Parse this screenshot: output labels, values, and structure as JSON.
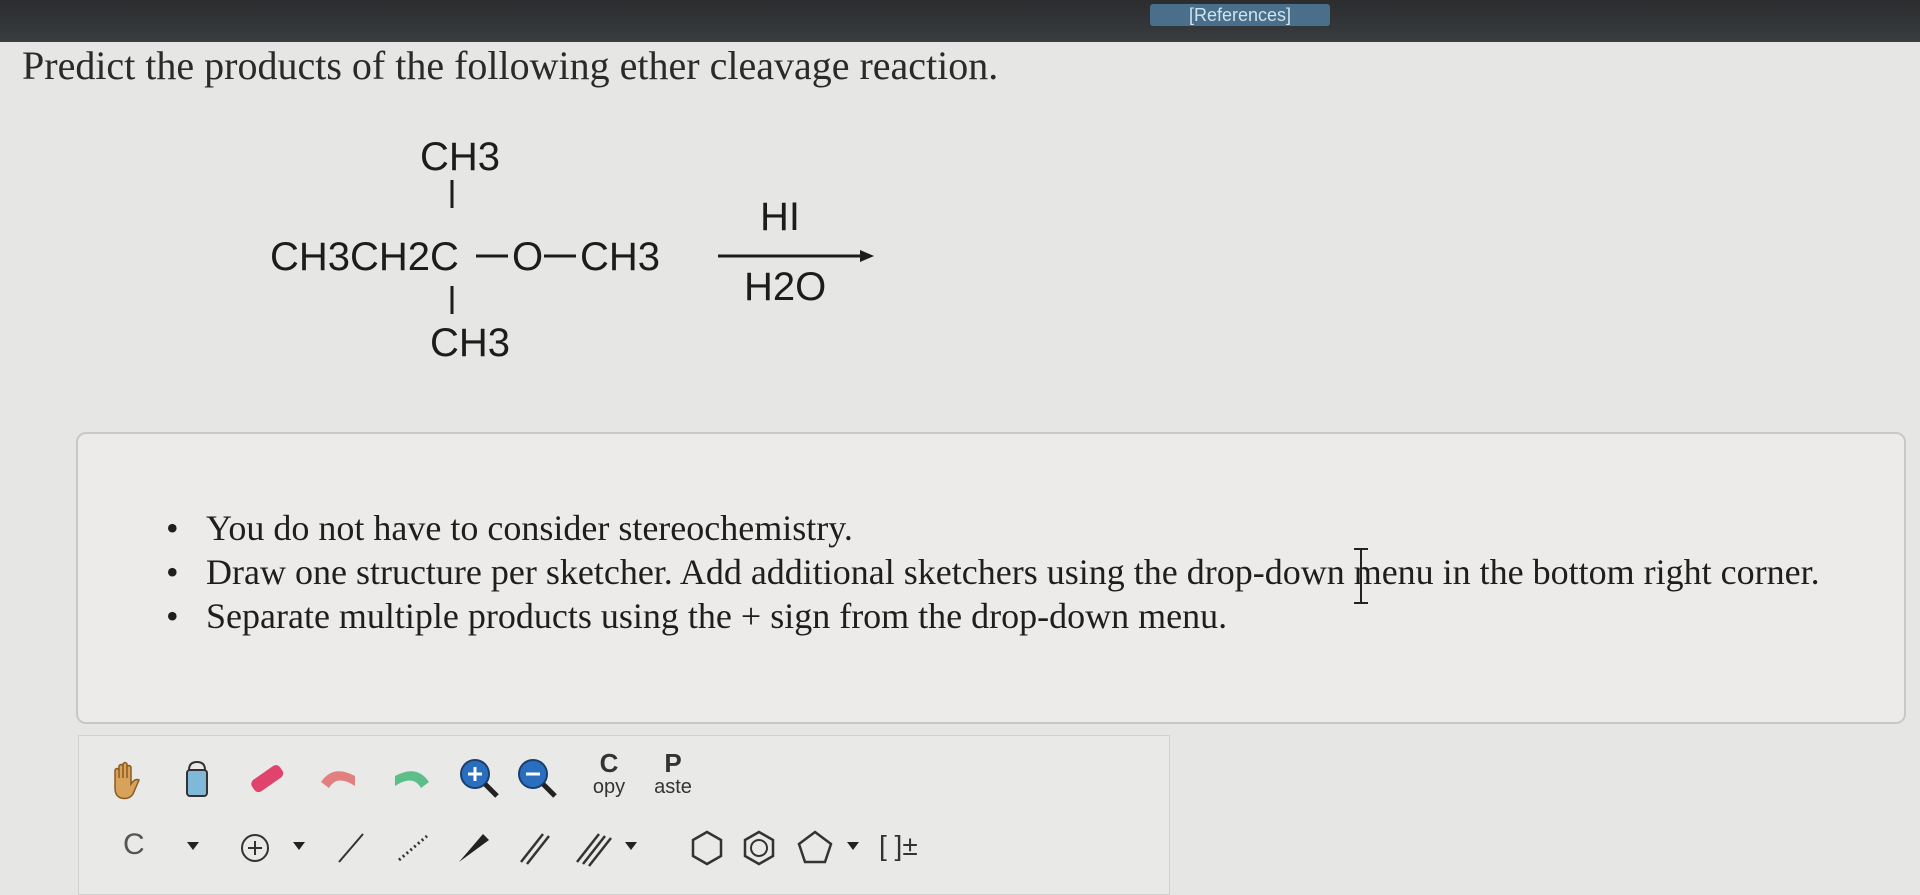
{
  "header": {
    "references_label": "[References]"
  },
  "question": {
    "text": "Predict the products of the following ether cleavage reaction."
  },
  "reaction": {
    "top_group": "CH3",
    "main_chain_left": "CH3CH2C",
    "oxygen": "O",
    "right_group": "CH3",
    "bottom_group": "CH3",
    "reagent_top": "HI",
    "reagent_bottom": "H2O"
  },
  "instructions": {
    "items": [
      "You do not have to consider stereochemistry.",
      "Draw one structure per sketcher. Add additional sketchers using the drop-down menu in the bottom right corner.",
      "Separate multiple products using the + sign from the drop-down menu."
    ]
  },
  "toolbar": {
    "copy_big": "C",
    "copy_small": "opy",
    "paste_big": "P",
    "paste_small": "aste",
    "element_label": "C",
    "bracket_label": "[ ]±"
  },
  "colors": {
    "accent": "#4a6f8a",
    "eraser": "#e0446c",
    "undo": "#e28080",
    "redo": "#5cbf8a",
    "zoom": "#2a6fbf"
  }
}
